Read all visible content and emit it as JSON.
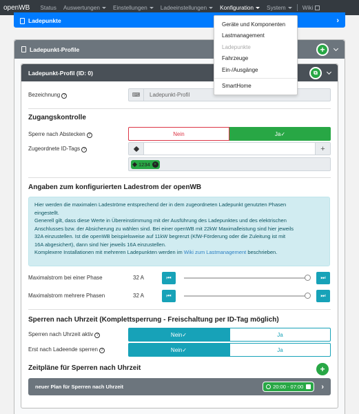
{
  "nav": {
    "brand": "openWB",
    "items": [
      "Status",
      "Auswertungen",
      "Einstellungen",
      "Ladeeinstellungen",
      "Konfiguration",
      "System",
      "Wiki"
    ]
  },
  "dropdown": {
    "items": [
      "Geräte und Komponenten",
      "Lastmanagement",
      "Ladepunkte",
      "Fahrzeuge",
      "Ein-/Ausgänge",
      "SmartHome"
    ]
  },
  "top_card": {
    "title": "Ladepunkte"
  },
  "profile_card": {
    "title": "Ladepunkt-Profile"
  },
  "profile": {
    "title": "Ladepunkt-Profil (ID: 0)",
    "name_label": "Bezeichnung",
    "name_value": "Ladepunkt-Profil",
    "access": {
      "title": "Zugangskontrolle",
      "lock_label": "Sperre nach Abstecken",
      "no": "Nein",
      "yes": "Ja",
      "tags_label": "Zugeordnete ID-Tags",
      "tag_value": "1234"
    },
    "current": {
      "title": "Angaben zum konfigurierten Ladestrom der openWB",
      "info_lines": [
        "Hier werden die maximalen Ladeströme entsprechend der in dem zugeordneten Ladepunkt genutzten Phasen",
        "eingestellt.",
        "Generell gilt, dass diese Werte in Übereinstimmung mit der Ausführung des Ladepunktes und des elektrischen",
        "Anschlusses bzw. der Absicherung zu wählen sind. Bei einer openWB mit 22kW Maximalleistung sind hier jeweils",
        "32A einzustellen. Ist die openWB beispielsweise auf 11kW begrenzt (KfW-Förderung oder die Zuleitung ist mit",
        "16A abgesichert), dann sind hier jeweils 16A einzustellen."
      ],
      "info_last_pre": "Komplexere Installationen mit mehreren Ladepunkten werden im ",
      "info_link": "Wiki zum Lastmanagement",
      "info_last_post": " beschrieben.",
      "max_one_label": "Maximalstrom bei einer Phase",
      "max_one_value": "32 A",
      "max_one_fraction": 1.0,
      "max_multi_label": "Maximalstrom mehrere Phasen",
      "max_multi_value": "32 A",
      "max_multi_fraction": 1.0
    },
    "time_lock": {
      "title": "Sperren nach Uhrzeit (Komplettsperrung - Freischaltung per ID-Tag möglich)",
      "active_label": "Sperren nach Uhrzeit aktiv",
      "after_end_label": "Erst nach Ladeende sperren",
      "no": "Nein",
      "yes": "Ja"
    },
    "schedules": {
      "title": "Zeitpläne für Sperren nach Uhrzeit",
      "plan_name": "neuer Plan für Sperren nach Uhrzeit",
      "plan_time": "20:00 - 07:00"
    }
  },
  "colors": {
    "primary": "#007bff",
    "success": "#28a745",
    "danger": "#dc3545",
    "info": "#17a2b8",
    "dark": "#343a40",
    "secondary": "#6c757d"
  }
}
